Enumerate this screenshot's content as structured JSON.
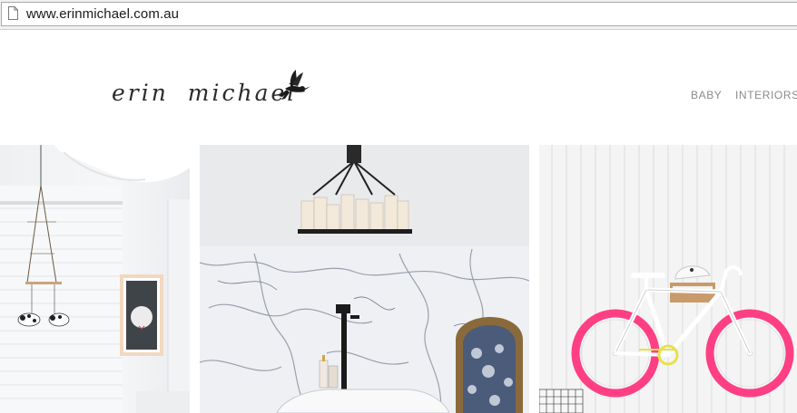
{
  "browser": {
    "url": "www.erinmichael.com.au",
    "icon": "page-icon"
  },
  "site": {
    "logo_text": "erin michael",
    "logo_icon": "hummingbird-icon",
    "nav": [
      {
        "label": "BABY"
      },
      {
        "label": "INTERIORS"
      }
    ]
  },
  "gallery": {
    "photos": [
      {
        "subject": "nursery",
        "icon": "nursery-photo"
      },
      {
        "subject": "marble bathroom",
        "icon": "bathroom-photo"
      },
      {
        "subject": "pink bicycle",
        "icon": "bicycle-photo"
      }
    ]
  },
  "colors": {
    "nav_text": "#8a8a8a",
    "logo_text": "#2b2b2b",
    "bike_rim": "#ff3f83"
  }
}
